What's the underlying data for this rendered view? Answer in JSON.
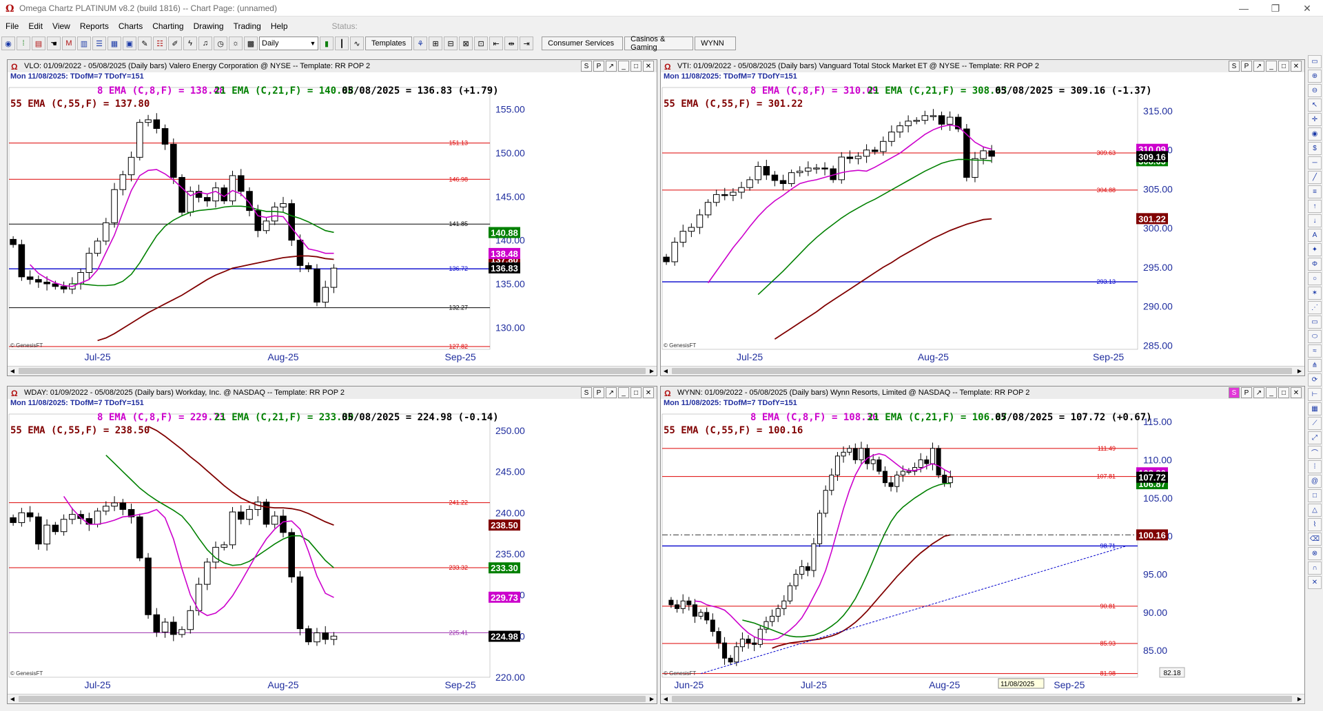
{
  "window": {
    "title": "Omega Chartz PLATINUM v8.2 (build 1816)  --  Chart Page: (unnamed)"
  },
  "menu": [
    "File",
    "Edit",
    "View",
    "Reports",
    "Charts",
    "Charting",
    "Drawing",
    "Trading",
    "Help"
  ],
  "toolbar": {
    "status_label": "Status:",
    "period_select": "Daily",
    "templates_label": "Templates",
    "page_tabs": [
      "Consumer Services",
      "Casinos & Gaming",
      "WYNN"
    ]
  },
  "icons": {
    "app": "omega-logo-icon",
    "win_min": "minimize-icon",
    "win_max": "restore-icon",
    "win_close": "close-icon"
  },
  "colors": {
    "ema8": "#cc00cc",
    "ema21": "#008000",
    "ema55": "#800000",
    "hline_red": "#dd0000",
    "hline_blue": "#0000cc",
    "hline_black": "#000000"
  },
  "panels": [
    {
      "id": "vlo",
      "header": "VLO:  01/09/2022 - 05/08/2025  (Daily bars)   Valero Energy Corporation @ NYSE  --  Template: RR POP 2",
      "subheader": "Mon   11/08/2025:   TDofM=7   TDofY=151",
      "ema8_label": "8 EMA (C,8,F) = 138.48",
      "ema21_label": "21 EMA (C,21,F) = 140.88",
      "last_label": "05/08/2025 = 136.83 (+1.79)",
      "ema55_label": "55 EMA (C,55,F) = 137.80",
      "credit": "© GenesisFT",
      "xlabels": [
        "Jul-25",
        "Aug-25",
        "Sep-25"
      ],
      "chart_data": {
        "type": "candlestick",
        "ylim": [
          127.5,
          157.5
        ],
        "yticks": [
          "155.00",
          "150.00",
          "145.00",
          "140.00",
          "135.00",
          "130.00"
        ],
        "yvals": [
          155,
          150,
          145,
          140,
          135,
          130
        ],
        "x_months": {
          "Jul-25": 10,
          "Aug-25": 32,
          "Sep-25": 53
        },
        "n_slots": 57,
        "hlines": [
          {
            "value": 151.13,
            "label": "151.13",
            "color": "red"
          },
          {
            "value": 146.98,
            "label": "146.98",
            "color": "red"
          },
          {
            "value": 141.85,
            "label": "141.85",
            "color": "black"
          },
          {
            "value": 136.72,
            "label": "136.72",
            "color": "blue"
          },
          {
            "value": 132.27,
            "label": "132.27",
            "color": "black"
          },
          {
            "value": 127.82,
            "label": "127.82",
            "color": "red"
          }
        ],
        "price_tags": [
          {
            "value": 140.88,
            "label": "140.88",
            "color": "#008000"
          },
          {
            "value": 137.8,
            "label": "137.80",
            "color": "#800000"
          },
          {
            "value": 138.48,
            "label": "138.48",
            "color": "#cc00cc"
          },
          {
            "value": 136.83,
            "label": "136.83",
            "color": "#000000"
          }
        ],
        "closes": [
          139.5,
          135.8,
          135.5,
          135.2,
          135.0,
          134.7,
          134.4,
          135.0,
          136.3,
          138.5,
          139.9,
          142.0,
          145.8,
          147.5,
          149.5,
          153.5,
          153.8,
          152.8,
          151.0,
          147.2,
          143.2,
          145.6,
          144.9,
          144.5,
          146.0,
          144.5,
          147.4,
          145.6,
          143.4,
          141.1,
          142.2,
          143.8,
          144.2,
          140.0,
          137.1,
          136.7,
          132.9,
          134.6,
          136.8
        ],
        "ema8": [
          137.2,
          136.2,
          135.6,
          135.1,
          134.8,
          134.7,
          135.1,
          135.5,
          136.6,
          138.6,
          140.6,
          143.2,
          145.7,
          147.4,
          148.0,
          148.1,
          147.6,
          146.9,
          146.0,
          145.1,
          145.5,
          145.3,
          145.6,
          145.0,
          145.7,
          145.3,
          144.3,
          142.8,
          142.6,
          142.8,
          142.7,
          141.4,
          140.2,
          139.0,
          138.8,
          138.5,
          138.5
        ],
        "ema21": [
          135.0,
          135.0,
          134.9,
          134.8,
          134.8,
          134.9,
          135.3,
          136.1,
          137.4,
          139.0,
          140.5,
          141.6,
          142.3,
          142.8,
          143.2,
          143.4,
          143.5,
          143.6,
          143.8,
          143.9,
          143.9,
          143.8,
          143.5,
          143.3,
          143.3,
          143.2,
          142.8,
          142.5,
          142.1,
          141.6,
          141.1,
          140.9
        ],
        "ema55": [
          128.5,
          128.8,
          129.3,
          129.9,
          130.5,
          131.1,
          131.7,
          132.2,
          132.7,
          133.2,
          133.7,
          134.3,
          134.9,
          135.5,
          136.0,
          136.4,
          136.8,
          137.0,
          137.2,
          137.4,
          137.6,
          137.8,
          138.0,
          138.1,
          138.2,
          138.2,
          138.1,
          137.9,
          137.8
        ]
      }
    },
    {
      "id": "vti",
      "header": "VTI:  01/09/2022 - 05/08/2025  (Daily bars)   Vanguard Total Stock Market ET @ NYSE  --  Template: RR POP 2",
      "subheader": "Mon   11/08/2025:   TDofM=7   TDofY=151",
      "ema8_label": "8 EMA (C,8,F) = 310.09",
      "ema21_label": "21 EMA (C,21,F) = 308.63",
      "last_label": "05/08/2025 = 309.16 (-1.37)",
      "ema55_label": "55 EMA (C,55,F) = 301.22",
      "credit": "© GenesisFT",
      "xlabels": [
        "Jul-25",
        "Aug-25",
        "Sep-25"
      ],
      "chart_data": {
        "type": "candlestick",
        "ylim": [
          284.5,
          318.0
        ],
        "yticks": [
          "315.00",
          "310.00",
          "305.00",
          "300.00",
          "295.00",
          "290.00",
          "285.00"
        ],
        "yvals": [
          315,
          310,
          305,
          300,
          295,
          290,
          285
        ],
        "x_months": {
          "Jul-25": 10,
          "Aug-25": 32,
          "Sep-25": 53
        },
        "n_slots": 57,
        "hlines": [
          {
            "value": 309.63,
            "label": "309.63",
            "color": "red"
          },
          {
            "value": 304.88,
            "label": "304.88",
            "color": "red"
          },
          {
            "value": 293.13,
            "label": "293.13",
            "color": "blue"
          }
        ],
        "price_tags": [
          {
            "value": 310.09,
            "label": "310.09",
            "color": "#cc00cc"
          },
          {
            "value": 308.63,
            "label": "308.63",
            "color": "#008000"
          },
          {
            "value": 309.16,
            "label": "309.16",
            "color": "#000000"
          },
          {
            "value": 301.22,
            "label": "301.22",
            "color": "#800000"
          }
        ],
        "closes": [
          295.7,
          298.2,
          299.6,
          300.1,
          301.7,
          303.3,
          304.3,
          304.2,
          304.6,
          305.2,
          306.2,
          307.9,
          306.8,
          306.1,
          305.7,
          307.1,
          307.3,
          307.7,
          307.7,
          307.6,
          306.2,
          309.1,
          308.9,
          309.2,
          310.0,
          309.8,
          311.1,
          312.3,
          313.1,
          313.7,
          313.8,
          314.4,
          314.4,
          313.3,
          314.2,
          312.7,
          306.5,
          308.9,
          309.9,
          309.2
        ],
        "ema8": [
          293.0,
          294.5,
          296.0,
          297.5,
          298.8,
          300.2,
          301.5,
          302.6,
          303.5,
          304.2,
          305.0,
          305.7,
          306.0,
          306.2,
          306.5,
          306.8,
          307.1,
          307.3,
          307.4,
          307.3,
          307.8,
          308.4,
          309.0,
          309.6,
          310.4,
          311.2,
          312.0,
          312.6,
          313.0,
          313.2,
          313.0,
          312.0,
          311.0,
          310.4,
          310.1
        ],
        "ema21": [
          291.5,
          292.5,
          293.5,
          294.5,
          295.6,
          296.7,
          297.8,
          298.8,
          299.7,
          300.5,
          301.3,
          302.0,
          302.6,
          303.2,
          303.7,
          304.3,
          304.9,
          305.5,
          306.1,
          306.7,
          307.3,
          307.8,
          308.3,
          308.6,
          308.8,
          308.8,
          308.7,
          308.7,
          308.6
        ],
        "ema55": [
          285.8,
          286.5,
          287.2,
          287.9,
          288.6,
          289.3,
          290.1,
          290.8,
          291.5,
          292.2,
          292.9,
          293.6,
          294.3,
          295.0,
          295.6,
          296.3,
          296.9,
          297.5,
          298.1,
          298.7,
          299.2,
          299.7,
          300.1,
          300.5,
          300.8,
          301.1,
          301.2
        ]
      }
    },
    {
      "id": "wday",
      "header": "WDAY:  01/09/2022 - 05/08/2025  (Daily bars)   Workday, Inc. @ NASDAQ  --  Template: RR POP 2",
      "subheader": "Mon   11/08/2025:   TDofM=7   TDofY=151",
      "ema8_label": "8 EMA (C,8,F) = 229.73",
      "ema21_label": "21 EMA (C,21,F) = 233.30",
      "last_label": "05/08/2025 = 224.98 (-0.14)",
      "ema55_label": "55 EMA (C,55,F) = 238.50",
      "credit": "© GenesisFT",
      "xlabels": [
        "Jul-25",
        "Aug-25",
        "Sep-25"
      ],
      "chart_data": {
        "type": "candlestick",
        "ylim": [
          220.0,
          252.0
        ],
        "yticks": [
          "250.00",
          "245.00",
          "240.00",
          "235.00",
          "230.00",
          "225.00",
          "220.00"
        ],
        "yvals": [
          250,
          245,
          240,
          235,
          230,
          225,
          220
        ],
        "x_months": {
          "Jul-25": 10,
          "Aug-25": 32,
          "Sep-25": 53
        },
        "n_slots": 57,
        "hlines": [
          {
            "value": 241.22,
            "label": "241.22",
            "color": "red"
          },
          {
            "value": 233.32,
            "label": "233.32",
            "color": "red"
          },
          {
            "value": 225.41,
            "label": "225.41",
            "color": "purple"
          }
        ],
        "price_tags": [
          {
            "value": 238.5,
            "label": "238.50",
            "color": "#800000"
          },
          {
            "value": 233.3,
            "label": "233.30",
            "color": "#008000"
          },
          {
            "value": 229.73,
            "label": "229.73",
            "color": "#cc00cc"
          },
          {
            "value": 224.98,
            "label": "224.98",
            "color": "#000000"
          }
        ],
        "closes": [
          238.8,
          240.0,
          239.5,
          236.2,
          238.5,
          237.7,
          239.2,
          239.8,
          239.3,
          238.6,
          240.2,
          240.8,
          241.2,
          240.4,
          239.5,
          234.5,
          227.6,
          225.5,
          226.7,
          225.2,
          225.8,
          228.1,
          231.3,
          234.0,
          235.8,
          236.1,
          240.1,
          239.2,
          240.4,
          241.3,
          238.6,
          239.6,
          237.6,
          232.2,
          225.9,
          224.3,
          225.4,
          224.6,
          225.0
        ],
        "ema8": [
          242.0,
          240.5,
          239.4,
          238.6,
          238.6,
          238.8,
          239.1,
          239.5,
          239.6,
          239.8,
          240.0,
          240.4,
          239.4,
          236.8,
          233.2,
          230.0,
          228.1,
          227.5,
          227.8,
          228.6,
          229.9,
          231.6,
          233.4,
          235.2,
          236.8,
          238.0,
          238.9,
          239.0,
          238.0,
          235.3,
          232.3,
          230.2,
          229.7
        ],
        "ema21": [
          247.0,
          246.0,
          245.0,
          244.0,
          243.0,
          242.2,
          241.5,
          240.9,
          240.3,
          239.6,
          238.4,
          236.9,
          235.5,
          234.5,
          233.9,
          233.6,
          233.7,
          234.1,
          234.8,
          235.5,
          236.2,
          236.8,
          237.2,
          237.2,
          236.6,
          235.4,
          234.2,
          233.3
        ],
        "ema55": [
          250.5,
          250.0,
          249.3,
          248.5,
          247.7,
          246.8,
          246.0,
          245.1,
          244.2,
          243.3,
          242.5,
          241.8,
          241.3,
          240.9,
          240.7,
          240.6,
          240.6,
          240.5,
          240.3,
          239.9,
          239.4,
          238.9,
          238.5
        ]
      }
    },
    {
      "id": "wynn",
      "header": "WYNN:  01/09/2022 - 05/08/2025  (Daily bars)   Wynn Resorts, Limited @ NASDAQ  --  Template: RR POP 2",
      "subheader": "Mon   11/08/2025:   TDofM=7   TDofY=151",
      "ema8_label": "8 EMA (C,8,F) = 108.30",
      "ema21_label": "21 EMA (C,21,F) = 106.87",
      "last_label": "05/08/2025 = 107.72 (+0.67)",
      "ema55_label": "55 EMA (C,55,F) = 100.16",
      "credit": "© GenesisFT",
      "xlabels": [
        "Jun-25",
        "Jul-25",
        "Aug-25",
        "Sep-25"
      ],
      "date_tag": "11/08/2025",
      "cursor_value": "82.18",
      "chart_data": {
        "type": "candlestick",
        "ylim": [
          81.5,
          116.0
        ],
        "yticks": [
          "115.00",
          "110.00",
          "105.00",
          "100.00",
          "95.00",
          "90.00",
          "85.00"
        ],
        "yvals": [
          115,
          110,
          105,
          100,
          95,
          90,
          85
        ],
        "x_months": {
          "Jun-25": 4,
          "Jul-25": 25,
          "Aug-25": 47,
          "Sep-25": 68
        },
        "n_slots": 80,
        "hlines": [
          {
            "value": 111.49,
            "label": "111.49",
            "color": "red"
          },
          {
            "value": 107.81,
            "label": "107.81",
            "color": "red"
          },
          {
            "value": 98.71,
            "label": "98.71",
            "color": "blue"
          },
          {
            "value": 90.81,
            "label": "90.81",
            "color": "red"
          },
          {
            "value": 85.93,
            "label": "85.93",
            "color": "red"
          },
          {
            "value": 81.98,
            "label": "81.98",
            "color": "red"
          }
        ],
        "price_tags": [
          {
            "value": 108.3,
            "label": "108.30",
            "color": "#cc00cc"
          },
          {
            "value": 106.87,
            "label": "106.87",
            "color": "#008000"
          },
          {
            "value": 107.72,
            "label": "107.72",
            "color": "#000000"
          },
          {
            "value": 100.16,
            "label": "100.16",
            "color": "#800000"
          }
        ],
        "closes": [
          91.0,
          90.5,
          91.5,
          91.0,
          89.5,
          90.0,
          89.0,
          87.5,
          86.0,
          84.0,
          83.5,
          85.5,
          86.5,
          86.0,
          85.8,
          87.8,
          88.8,
          89.5,
          90.5,
          91.5,
          93.5,
          95.0,
          96.0,
          95.5,
          99.0,
          103.0,
          106.0,
          108.0,
          110.5,
          111.0,
          111.5,
          110.0,
          111.5,
          109.5,
          110.0,
          108.5,
          107.0,
          106.5,
          108.0,
          108.5,
          108.5,
          109.0,
          110.0,
          109.5,
          111.5,
          108.0,
          107.0,
          107.72
        ],
        "ema8": [
          91.5,
          91.4,
          91.0,
          90.8,
          90.6,
          90.3,
          89.6,
          88.8,
          88.0,
          87.3,
          86.8,
          86.5,
          86.4,
          86.4,
          86.6,
          87.1,
          87.7,
          88.4,
          89.3,
          90.6,
          92.1,
          93.6,
          95.5,
          98.0,
          100.8,
          103.6,
          106.0,
          108.0,
          109.4,
          110.2,
          110.6,
          110.8,
          110.6,
          110.0,
          109.4,
          108.8,
          108.6,
          108.6,
          108.8,
          109.2,
          109.5,
          109.2,
          108.7,
          108.3
        ],
        "ema21": [
          89.0,
          88.8,
          88.6,
          88.3,
          88.0,
          87.7,
          87.4,
          87.1,
          86.9,
          86.8,
          86.8,
          86.9,
          87.0,
          87.3,
          87.7,
          88.2,
          88.8,
          89.6,
          90.6,
          91.8,
          93.3,
          95.0,
          96.8,
          98.7,
          100.4,
          101.9,
          103.0,
          103.8,
          104.4,
          105.0,
          105.5,
          106.0,
          106.4,
          106.7,
          106.9,
          106.9
        ],
        "ema55": [
          85.3,
          85.6,
          85.8,
          86.0,
          86.1,
          86.2,
          86.3,
          86.4,
          86.5,
          86.7,
          86.9,
          87.2,
          87.6,
          88.1,
          88.7,
          89.4,
          90.2,
          91.1,
          92.0,
          92.9,
          93.8,
          94.7,
          95.5,
          96.3,
          97.1,
          97.8,
          98.4,
          99.0,
          99.5,
          100.0,
          100.16
        ]
      }
    }
  ]
}
